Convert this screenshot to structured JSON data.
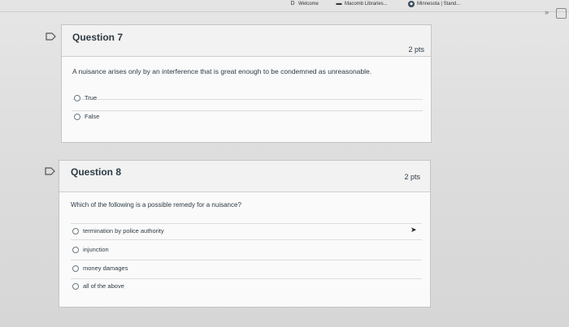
{
  "bookmarks": [
    {
      "label": "Welcome",
      "icon": "d-icon"
    },
    {
      "label": "Macomb Libraries...",
      "icon": "library-icon"
    },
    {
      "label": "Minnesota | Stand...",
      "icon": "globe-icon"
    }
  ],
  "toolbar": {
    "overflow_label": "»"
  },
  "questions": [
    {
      "title": "Question 7",
      "points": "2 pts",
      "text": "A nuisance arises only by an interference that is great enough to be condemned as unreasonable.",
      "answers": [
        "True",
        "False"
      ]
    },
    {
      "title": "Question 8",
      "points": "2 pts",
      "text": "Which of the following is a possible remedy for a nuisance?",
      "answers": [
        "termination by police authority",
        "injunction",
        "money damages",
        "all of the above"
      ]
    }
  ]
}
